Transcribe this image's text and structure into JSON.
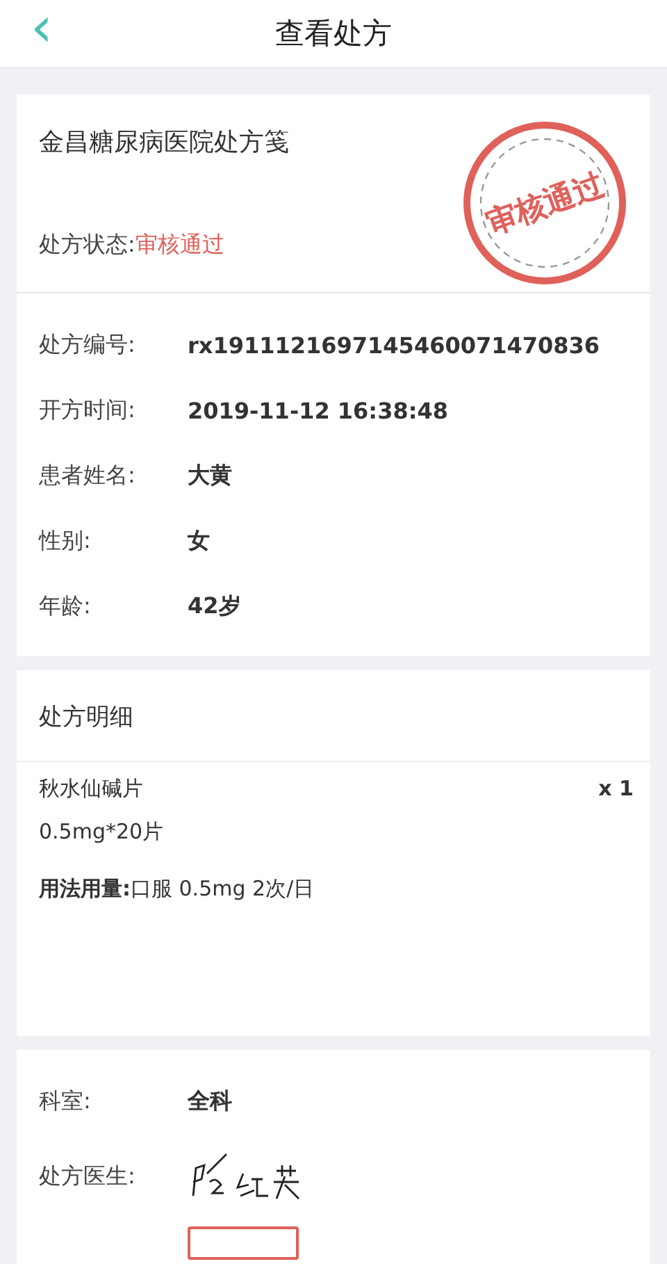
{
  "header": {
    "back_icon": "‹",
    "title": "查看处方"
  },
  "prescription": {
    "hospital": "金昌糖尿病医院处方笺",
    "status_label": "处方状态:",
    "status_value": "审核通过",
    "stamp_text": "审核通过"
  },
  "info": [
    {
      "label": "处方编号:",
      "value": "rx1911121697145460071470836"
    },
    {
      "label": "开方时间:",
      "value": "2019-11-12 16:38:48"
    },
    {
      "label": "患者姓名:",
      "value": "大黄"
    },
    {
      "label": "性别:",
      "value": "女"
    },
    {
      "label": "年龄:",
      "value": "42岁"
    }
  ],
  "details": {
    "title": "处方明细",
    "drugs": [
      {
        "name": "秋水仙碱片",
        "quantity": "x 1",
        "spec": "0.5mg*20片",
        "usage_label": "用法用量:",
        "usage": "口服 0.5mg 2次/日"
      }
    ]
  },
  "doctor": [
    {
      "kind": "text",
      "label": "科室:",
      "value": "全科"
    },
    {
      "kind": "signature",
      "label": "处方医生:"
    },
    {
      "kind": "seal"
    }
  ]
}
